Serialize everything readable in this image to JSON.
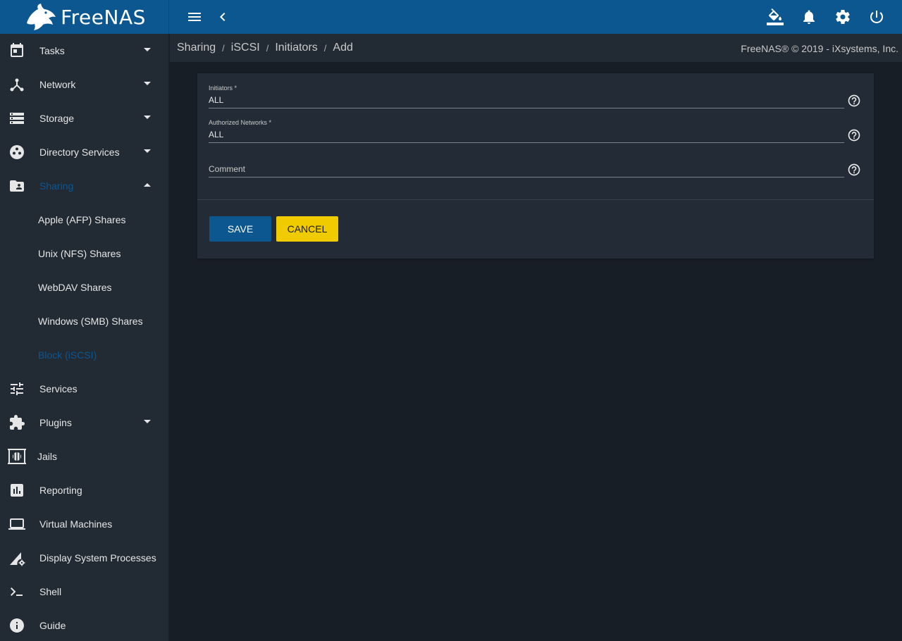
{
  "app": {
    "brand": "FreeNAS",
    "copyright": "FreeNAS® © 2019 - iXsystems, Inc."
  },
  "topbar": {
    "icons": [
      "menu-icon",
      "chevron-left-icon",
      "paint-bucket-icon",
      "bell-icon",
      "gear-icon",
      "power-icon"
    ]
  },
  "breadcrumb": {
    "items": [
      "Sharing",
      "iSCSI",
      "Initiators",
      "Add"
    ],
    "separator": "/"
  },
  "sidebar": {
    "items": [
      {
        "label": "Tasks",
        "icon": "calendar-icon"
      },
      {
        "label": "Network",
        "icon": "network-icon"
      },
      {
        "label": "Storage",
        "icon": "storage-icon"
      },
      {
        "label": "Directory Services",
        "icon": "directory-services-icon"
      },
      {
        "label": "Sharing",
        "icon": "folder-shared-icon"
      },
      {
        "label": "Services",
        "icon": "sliders-icon"
      },
      {
        "label": "Plugins",
        "icon": "puzzle-icon"
      },
      {
        "label": "Jails",
        "icon": "jail-icon"
      },
      {
        "label": "Reporting",
        "icon": "chart-icon"
      },
      {
        "label": "Virtual Machines",
        "icon": "laptop-icon"
      },
      {
        "label": "Display System Processes",
        "icon": "processes-icon"
      },
      {
        "label": "Shell",
        "icon": "terminal-icon"
      },
      {
        "label": "Guide",
        "icon": "info-icon"
      }
    ],
    "sharing_sub": [
      {
        "label": "Apple (AFP) Shares"
      },
      {
        "label": "Unix (NFS) Shares"
      },
      {
        "label": "WebDAV Shares"
      },
      {
        "label": "Windows (SMB) Shares"
      },
      {
        "label": "Block (iSCSI)"
      }
    ],
    "active_color": "#0c5790"
  },
  "form": {
    "initiators": {
      "label": "Initiators *",
      "value": "ALL"
    },
    "authorized_networks": {
      "label": "Authorized Networks *",
      "value": "ALL"
    },
    "comment": {
      "placeholder": "Comment",
      "value": ""
    },
    "save_label": "SAVE",
    "cancel_label": "CANCEL"
  },
  "colors": {
    "topbar": "#0c5790",
    "sidebar": "#222a33",
    "background": "#181e26",
    "save_button": "#0c5790",
    "cancel_button": "#f0cb00"
  }
}
